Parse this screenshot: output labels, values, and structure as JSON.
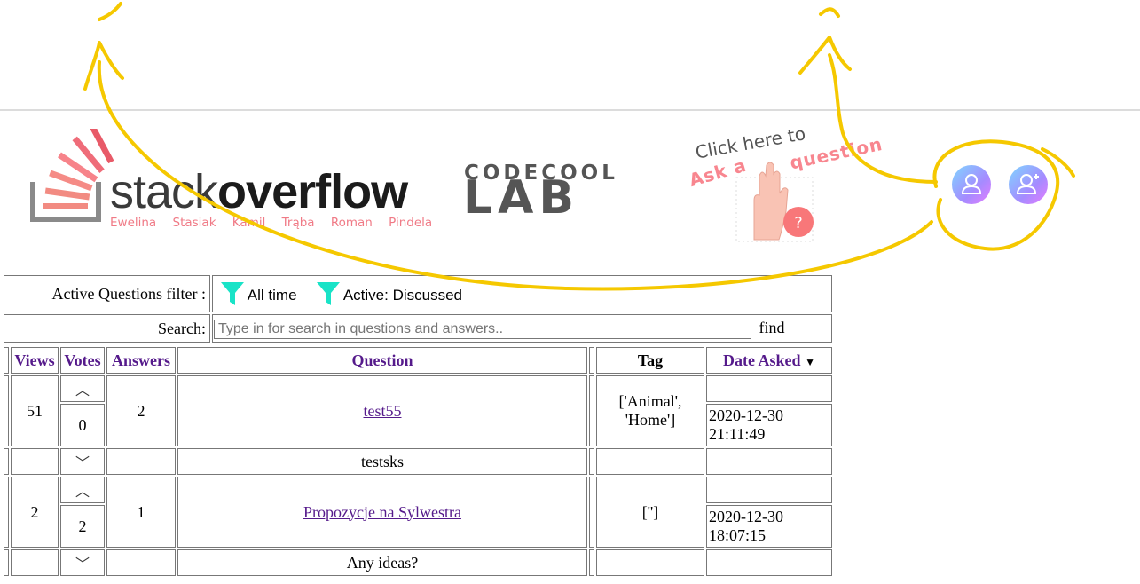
{
  "header": {
    "logo_word_light": "stack",
    "logo_word_bold": "overflow",
    "authors": "Ewelina Stasiak   Kamil Trąba   Roman Pindela",
    "partner_top": "CODECOOL",
    "partner_bottom": "LAB",
    "ask_line1": "Click here to",
    "ask_line2": "Ask a",
    "ask_line3": "question"
  },
  "filter": {
    "label": "Active Questions filter :",
    "items": [
      "All time",
      "Active: Discussed"
    ],
    "accent": "#19e3c7"
  },
  "search": {
    "label": "Search:",
    "placeholder": "Type in for search in questions and answers..",
    "button": "find"
  },
  "table": {
    "headers": {
      "views": "Views",
      "votes": "Votes",
      "answers": "Answers",
      "question": "Question",
      "tag": "Tag",
      "date": "Date Asked",
      "sort_icon": "▼"
    },
    "rows": [
      {
        "views": "51",
        "votes": "0",
        "answers": "2",
        "title": "test55",
        "tags": "['Animal', 'Home']",
        "date": "2020-12-30",
        "time": "21:11:49",
        "message": "testsks"
      },
      {
        "views": "2",
        "votes": "2",
        "answers": "1",
        "title": "Propozycje na Sylwestra",
        "tags": "['']",
        "date": "2020-12-30",
        "time": "18:07:15",
        "message": "Any ideas?"
      }
    ]
  },
  "colors": {
    "annotation": "#f5c800",
    "logo_accent": "#f07a86"
  }
}
